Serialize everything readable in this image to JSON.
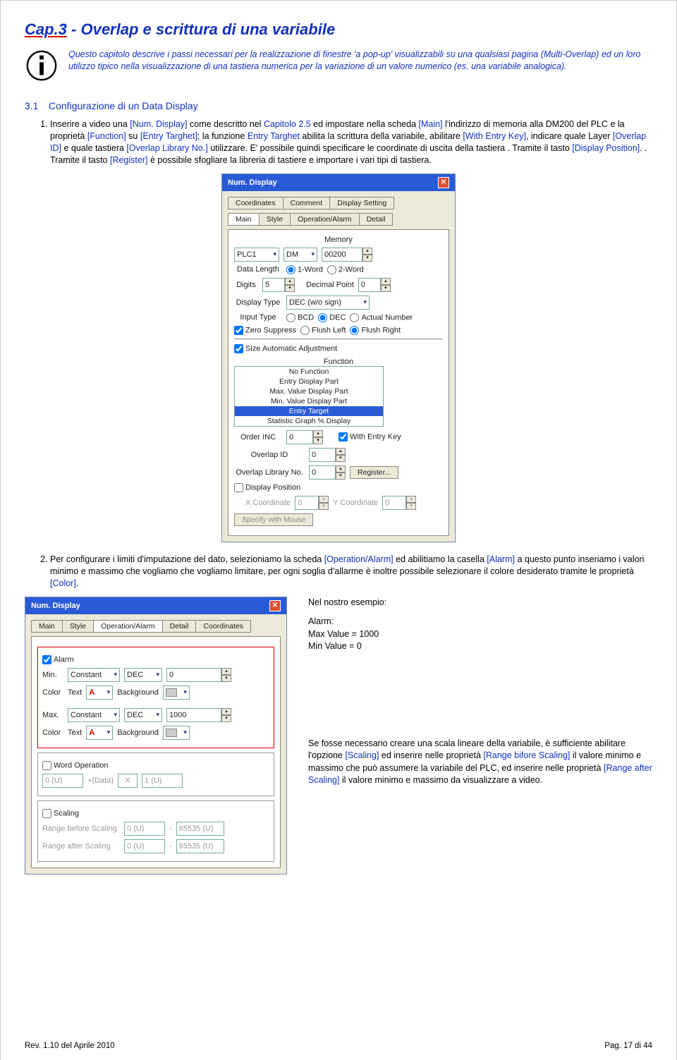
{
  "chapter": {
    "titlePrefix": "Cap.3",
    "titleRest": " - Overlap e scrittura di una variabile",
    "intro": "Questo capitolo descrive i passi necessari per la realizzazione di finestre 'a pop-up' visualizzabili su una qualsiasi pagina (Multi-Overlap) ed un loro utilizzo tipico nella visualizzazione di una tastiera numerica per la variazione di un valore numerico (es. una variabile analogica)."
  },
  "section": {
    "num": "3.1",
    "title": "Configurazione di un Data Display"
  },
  "step1": {
    "t1": "Inserire a video una ",
    "l1": "[Num. Display]",
    "t2": " come descritto nel ",
    "l2": "Capitolo 2.5",
    "t3": " ed impostare nella scheda ",
    "l3": "[Main]",
    "t4": " l'indirizzo di memoria alla DM200 del PLC e la proprietà ",
    "l4": "[Function]",
    "t5": " su ",
    "l5": "[Entry Targhet]",
    "t6": "; la funzione ",
    "l6": "Entry Targhet",
    "t7": " abilita la scrittura della variabile, abilitare ",
    "l7": "[With Entry Key]",
    "t8": ", indicare quale Layer ",
    "l8": "[Overlap ID]",
    "t9": " e quale tastiera ",
    "l9": "[Overlap Library No.]",
    "t10": " utilizzare. E' possibile quindi specificare le coordinate di uscita della tastiera ",
    "l10": "[Display Position]",
    "t11": ". Tramite il tasto ",
    "l11": "[Register]",
    "t12": " è possibile sfogliare la libreria di tastiere e importare i vari tipi di tastiera."
  },
  "dlg1": {
    "title": "Num. Display",
    "tabs": {
      "coordinates": "Coordinates",
      "comment": "Comment",
      "dispSetting": "Display Setting",
      "main": "Main",
      "style": "Style",
      "opalarm": "Operation/Alarm",
      "detail": "Detail"
    },
    "memory": "Memory",
    "plc": "PLC1",
    "dm": "DM",
    "addr": "00200",
    "dataLen": "Data Length",
    "w1": "1-Word",
    "w2": "2-Word",
    "digits": "Digits",
    "digitsVal": "5",
    "decPt": "Decimal Point",
    "decVal": "0",
    "dispType": "Display Type",
    "dispTypeVal": "DEC (w/o sign)",
    "inputType": "Input Type",
    "bcd": "BCD",
    "dec": "DEC",
    "actNum": "Actual Number",
    "zeroSup": "Zero Suppress",
    "flushL": "Flush Left",
    "flushR": "Flush Right",
    "sizeAuto": "Size Automatic Adjustment",
    "function": "Function",
    "funcList": {
      "a": "No Function",
      "b": "Entry Display Part",
      "c": "Max. Value Display Part",
      "d": "Min. Value Display Part",
      "e": "Entry Target",
      "f": "Statistic Graph % Display"
    },
    "orderInc": "Order INC",
    "orderVal": "0",
    "withEntry": "With Entry Key",
    "overlapId": "Overlap ID",
    "overlapIdVal": "0",
    "overlapLib": "Overlap Library No.",
    "overlapLibVal": "0",
    "register": "Register...",
    "dispPos": "Display Position",
    "xcoord": "X Coordinate",
    "xval": "0",
    "ycoord": "Y Coordinate",
    "yval": "0",
    "specMouse": "Specify with Mouse"
  },
  "step2": {
    "t1": "Per configurare i limiti d'imputazione del dato, selezioniamo la scheda ",
    "l1": "[Operation/Alarm]",
    "t2": " ed abilitiamo la casella ",
    "l2": "[Alarm]",
    "t3": " a questo punto inseriamo i valori minimo e massimo che vogliamo che vogliamo limitare, per ogni soglia d'allarme è inoltre possibile selezionare il colore desiderato tramite le proprietà ",
    "l3": "[Color]",
    "t4": "."
  },
  "dlg2": {
    "title": "Num. Display",
    "tabs": {
      "main": "Main",
      "style": "Style",
      "opalarm": "Operation/Alarm",
      "detail": "Detail",
      "coordinates": "Coordinates"
    },
    "alarm": "Alarm",
    "min": "Min.",
    "max": "Max.",
    "constant": "Constant",
    "dec": "DEC",
    "minVal": "0",
    "maxVal": "1000",
    "color": "Color",
    "text": "Text",
    "bg": "Background",
    "wordOp": "Word Operation",
    "zeroU": "0 (U)",
    "oneU": "1 (U)",
    "plusData": "+(Data)",
    "mult": "X",
    "scaling": "Scaling",
    "rbs": "Range before Scaling",
    "ras": "Range after Scaling",
    "max16": "65535 (U)"
  },
  "side": {
    "hd": "Nel nostro esempio:",
    "alarm": "Alarm:",
    "max": "Max Value = 1000",
    "min": "Min Value = 0",
    "p2a": "Se fosse necessario creare una scala lineare della variabile, è sufficiente abilitare l'opzione ",
    "l1": "[Scaling]",
    "p2b": " ed inserire nelle proprietà ",
    "l2": "[Range bifore Scaling]",
    "p2c": " il valore minimo e massimo che può assumere la variabile del PLC, ed inserire nelle proprietà ",
    "l3": "[Range after Scaling]",
    "p2d": " il valore minimo e massimo da visualizzare a video."
  },
  "footer": {
    "left": "Rev. 1.10 del Aprile 2010",
    "right": "Pag. 17 di 44"
  }
}
